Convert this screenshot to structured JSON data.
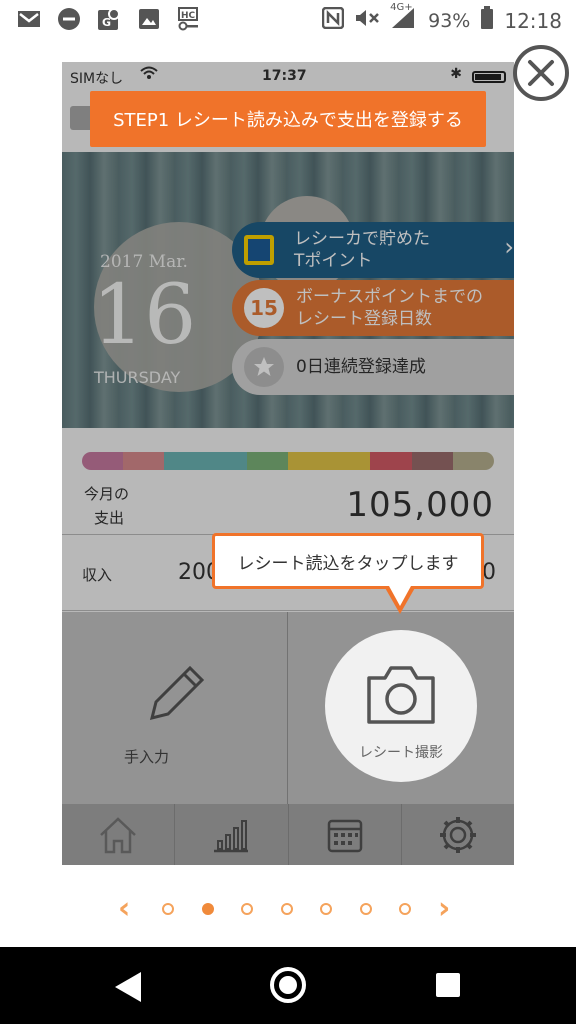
{
  "status_bar": {
    "battery": "93%",
    "time": "12:18",
    "network": "4G+",
    "icons": [
      "gmail-icon",
      "do-not-disturb-icon",
      "maps-icon",
      "photos-icon",
      "hc-key-icon",
      "nfc-icon",
      "mute-icon",
      "signal-icon",
      "battery-icon"
    ]
  },
  "phone": {
    "carrier": "SIMなし",
    "time": "17:37",
    "date": {
      "year_month": "2017 Mar.",
      "day": "16",
      "weekday": "THURSDAY"
    },
    "cards": {
      "tpoint_line1": "レシーカで貯めた",
      "tpoint_line2": "Tポイント",
      "bonus_badge": "15",
      "bonus_line1": "ボーナスポイントまでの",
      "bonus_line2": "レシート登録日数",
      "streak": "0日連続登録達成"
    },
    "spending": {
      "label_line1": "今月の",
      "label_line2": "支出",
      "amount": "105,000"
    },
    "income": {
      "label": "収入",
      "amount_partial": "200",
      "amount_tail": "0"
    },
    "actions": {
      "manual": "手入力",
      "receipt": "レシート撮影"
    },
    "tabs": [
      "home-icon",
      "chart-icon",
      "calendar-icon",
      "settings-icon"
    ],
    "bar_colors": [
      "#c77aa0",
      "#d98b8e",
      "#6bb5b5",
      "#6bb5b5",
      "#7cb37a",
      "#e2c447",
      "#e2c447",
      "#d35b66",
      "#9b6d6d",
      "#b7b08f"
    ]
  },
  "tutorial": {
    "step_banner": "STEP1  レシート読み込みで支出を登録する",
    "callout": "レシート読込をタップします",
    "accent": "#f0732a",
    "page_count": 7,
    "active_page": 2
  }
}
